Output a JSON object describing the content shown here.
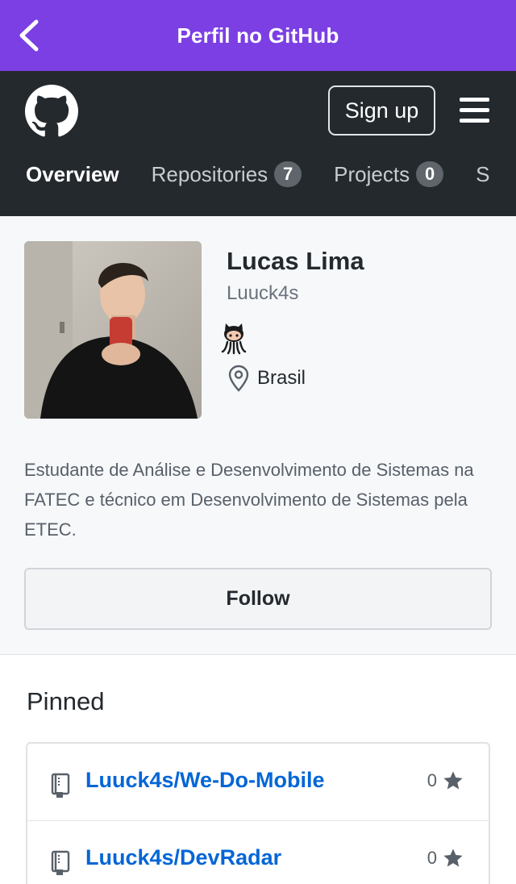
{
  "appbar": {
    "title": "Perfil no GitHub"
  },
  "header": {
    "signup_label": "Sign up",
    "tabs": [
      {
        "label": "Overview",
        "count": null
      },
      {
        "label": "Repositories",
        "count": "7"
      },
      {
        "label": "Projects",
        "count": "0"
      },
      {
        "label": "S",
        "count": null
      }
    ]
  },
  "profile": {
    "name": "Lucas Lima",
    "login": "Luuck4s",
    "location": "Brasil",
    "bio": "Estudante de Análise e Desenvolvimento de Sistemas na FATEC e técnico em Desenvolvimento de Sistemas pela ETEC.",
    "follow_label": "Follow"
  },
  "pinned": {
    "title": "Pinned",
    "items": [
      {
        "name": "Luuck4s/We-Do-Mobile",
        "stars": "0"
      },
      {
        "name": "Luuck4s/DevRadar",
        "stars": "0"
      }
    ]
  },
  "colors": {
    "appbar": "#7b3fe4",
    "header": "#24292e",
    "link": "#0366d6"
  },
  "icons": [
    "back-arrow-icon",
    "github-logo-icon",
    "hamburger-menu-icon",
    "octocat-emoji-icon",
    "location-pin-icon",
    "repo-book-icon",
    "star-icon"
  ]
}
